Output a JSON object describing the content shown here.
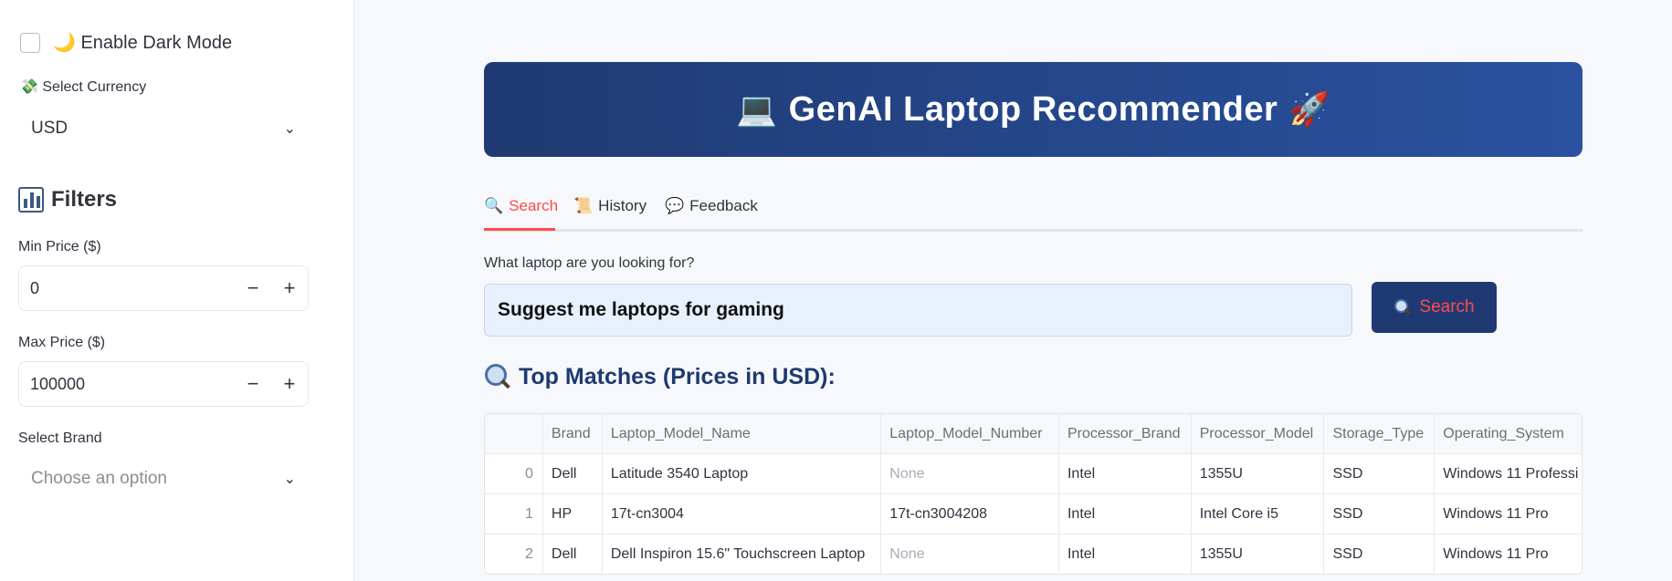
{
  "sidebar": {
    "dark_mode_label": "🌙 Enable Dark Mode",
    "currency_label": "💸 Select Currency",
    "currency_value": "USD",
    "filters_title": "Filters",
    "min_price_label": "Min Price ($)",
    "min_price_value": "0",
    "max_price_label": "Max Price ($)",
    "max_price_value": "100000",
    "brand_label": "Select Brand",
    "brand_placeholder": "Choose an option",
    "minus": "−",
    "plus": "+"
  },
  "header": {
    "title": "GenAI Laptop Recommender",
    "left_emoji": "💻",
    "right_emoji": "🚀"
  },
  "tabs": [
    {
      "label": "Search",
      "icon": "🔍"
    },
    {
      "label": "History",
      "icon": "📜"
    },
    {
      "label": "Feedback",
      "icon": "💬"
    }
  ],
  "query": {
    "label": "What laptop are you looking for?",
    "value": "Suggest me laptops for gaming",
    "button_label": "Search"
  },
  "results": {
    "title": "Top Matches (Prices in USD):",
    "columns": [
      "",
      "Brand",
      "Laptop_Model_Name",
      "Laptop_Model_Number",
      "Processor_Brand",
      "Processor_Model",
      "Storage_Type",
      "Operating_System"
    ],
    "rows": [
      [
        "0",
        "Dell",
        "Latitude 3540 Laptop",
        "None",
        "Intel",
        "1355U",
        "SSD",
        "Windows 11 Professi"
      ],
      [
        "1",
        "HP",
        "17t-cn3004",
        "17t-cn3004208",
        "Intel",
        "Intel Core i5",
        "SSD",
        "Windows 11 Pro"
      ],
      [
        "2",
        "Dell",
        "Dell Inspiron 15.6\" Touchscreen Laptop",
        "None",
        "Intel",
        "1355U",
        "SSD",
        "Windows 11 Pro"
      ]
    ]
  },
  "colors": {
    "accent": "#ff4b4b",
    "brand": "#1f3a72"
  }
}
